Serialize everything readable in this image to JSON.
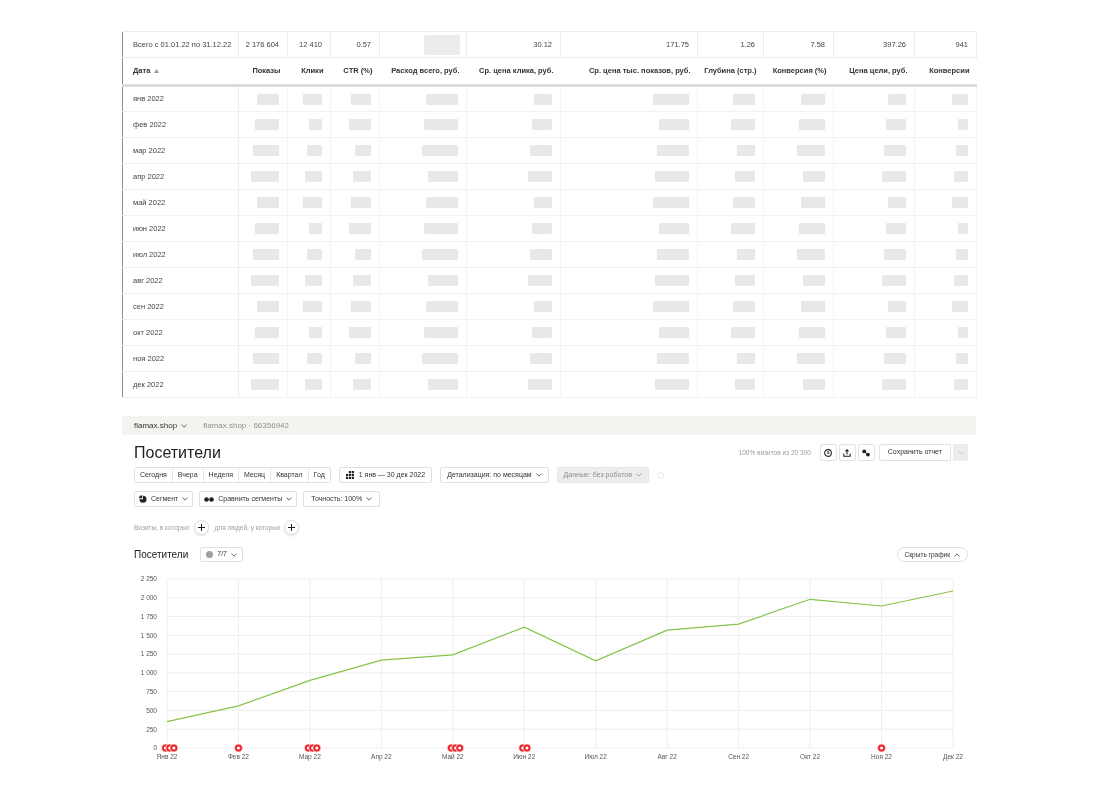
{
  "stats_table": {
    "total_row": {
      "label": "Всего с 01.01.22 по 31.12.22",
      "cells": [
        {
          "kind": "value",
          "text": "2 176 604"
        },
        {
          "kind": "value",
          "text": "12 410"
        },
        {
          "kind": "value",
          "text": "0.57"
        },
        {
          "kind": "redacted"
        },
        {
          "kind": "value",
          "text": "30.12"
        },
        {
          "kind": "value",
          "text": "171.75"
        },
        {
          "kind": "value",
          "text": "1.26"
        },
        {
          "kind": "value",
          "text": "7.58"
        },
        {
          "kind": "value",
          "text": "397.26"
        },
        {
          "kind": "value",
          "text": "941"
        }
      ]
    },
    "columns": [
      {
        "label": "Дата",
        "sorted": true
      },
      {
        "label": "Показы",
        "sorted": false
      },
      {
        "label": "Клики",
        "sorted": false
      },
      {
        "label": "CTR (%)",
        "sorted": false
      },
      {
        "label": "Расход всего, руб.",
        "sorted": false
      },
      {
        "label": "Ср. цена клика, руб.",
        "sorted": false
      },
      {
        "label": "Ср. цена тыс. показов, руб.",
        "sorted": false
      },
      {
        "label": "Глубина (стр.)",
        "sorted": false
      },
      {
        "label": "Конверсия (%)",
        "sorted": false
      },
      {
        "label": "Цена цели, руб.",
        "sorted": false
      },
      {
        "label": "Конверсии",
        "sorted": false
      }
    ],
    "rows": [
      {
        "label": "янв 2022",
        "redacted": true
      },
      {
        "label": "фев 2022",
        "redacted": true
      },
      {
        "label": "мар 2022",
        "redacted": true
      },
      {
        "label": "апр 2022",
        "redacted": true
      },
      {
        "label": "май 2022",
        "redacted": true
      },
      {
        "label": "июн 2022",
        "redacted": true
      },
      {
        "label": "июл 2022",
        "redacted": true
      },
      {
        "label": "авг 2022",
        "redacted": true
      },
      {
        "label": "сен 2022",
        "redacted": true
      },
      {
        "label": "окт 2022",
        "redacted": true
      },
      {
        "label": "ноя 2022",
        "redacted": true
      },
      {
        "label": "дек 2022",
        "redacted": true
      }
    ]
  },
  "report": {
    "breadcrumb": {
      "counter": "flamax.shop",
      "counter_id": "flamax.shop · 66356942"
    },
    "title": "Посетители",
    "sample_note": "100% визитов из 20 390",
    "save_button": "Сохранить отчет",
    "period_buttons": [
      {
        "label": "Сегодня",
        "selected": false
      },
      {
        "label": "Вчера",
        "selected": false
      },
      {
        "label": "Неделя",
        "selected": false
      },
      {
        "label": "Месяц",
        "selected": false
      },
      {
        "label": "Квартал",
        "selected": false
      },
      {
        "label": "Год",
        "selected": false
      }
    ],
    "date_range": "1 янв — 30 дек 2022",
    "detail_dropdown": "Детализация: по месяцам",
    "data_dropdown": {
      "label": "Данные: без роботов",
      "disabled": true
    },
    "segment_buttons": [
      {
        "kind": "segment",
        "label": "Сегмент"
      },
      {
        "kind": "compare",
        "label": "Сравнить сегменты"
      },
      {
        "kind": "accuracy",
        "label": "Точность: 100%"
      }
    ],
    "filters": [
      {
        "label": "Визиты, в которых"
      },
      {
        "label": "для людей, у которых"
      }
    ],
    "chart_section": {
      "title": "Посетители",
      "series_selector": "7/7",
      "hide_button": "Скрыть график",
      "chart_data": {
        "type": "line",
        "categories": [
          "Янв 22",
          "Фев 22",
          "Мар 22",
          "Апр 22",
          "Май 22",
          "Июн 22",
          "Июл 22",
          "Авг 22",
          "Сен 22",
          "Окт 22",
          "Ноя 22",
          "Дек 22"
        ],
        "values": [
          350,
          560,
          900,
          1170,
          1240,
          1610,
          1160,
          1570,
          1650,
          1980,
          1890,
          2090
        ],
        "ylim": [
          0,
          2250
        ],
        "yticks": [
          {
            "value": 0,
            "label": "0"
          },
          {
            "value": 250,
            "label": "250"
          },
          {
            "value": 500,
            "label": "500"
          },
          {
            "value": 750,
            "label": "750"
          },
          {
            "value": 1000,
            "label": "1 000"
          },
          {
            "value": 1250,
            "label": "1 250"
          },
          {
            "value": 1500,
            "label": "1 500"
          },
          {
            "value": 1750,
            "label": "1 750"
          },
          {
            "value": 2000,
            "label": "2 000"
          },
          {
            "value": 2250,
            "label": "2 250"
          }
        ],
        "grid": true,
        "annotations": [
          {
            "x": "Янв 22"
          },
          {
            "x": "Янв 22"
          },
          {
            "x": "Янв 22"
          },
          {
            "x": "Фев 22"
          },
          {
            "x": "Мар 22"
          },
          {
            "x": "Мар 22"
          },
          {
            "x": "Мар 22"
          },
          {
            "x": "Май 22"
          },
          {
            "x": "Май 22"
          },
          {
            "x": "Май 22"
          },
          {
            "x": "Июн 22"
          },
          {
            "x": "Июн 22"
          },
          {
            "x": "Ноя 22"
          }
        ]
      }
    }
  }
}
